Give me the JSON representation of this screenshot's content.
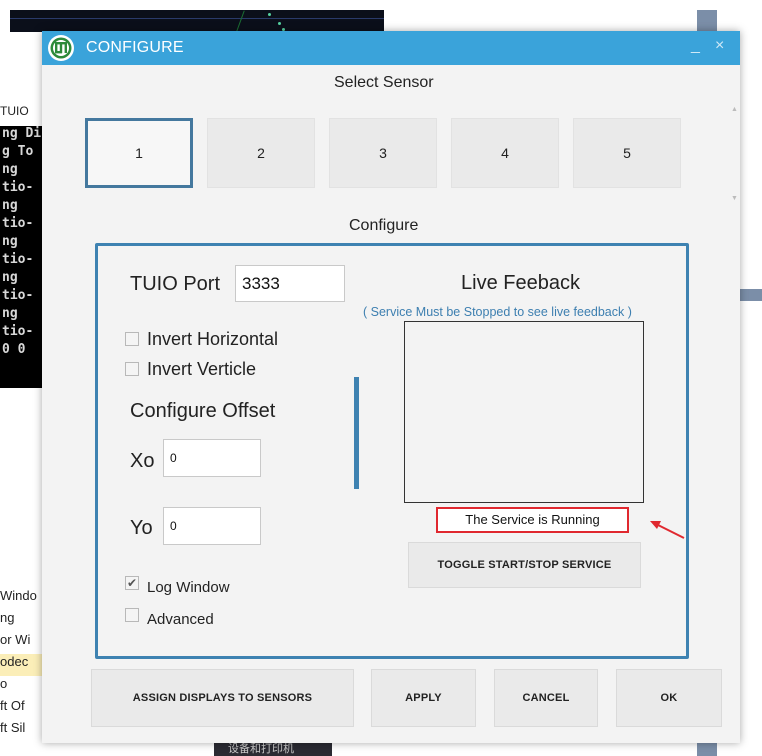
{
  "background": {
    "tuio_label": "TUIO",
    "console_lines": [
      "ng Di",
      "g To",
      "ng",
      "tio-",
      "ng",
      "tio-",
      "ng",
      "tio-",
      "ng",
      "tio-",
      "ng",
      "tio-",
      "0 0"
    ],
    "list_items": [
      "Windo",
      "ng",
      "or Wi",
      "odec",
      "o",
      "ft Of",
      "ft Sil"
    ],
    "bottom_text": "设备和打印机"
  },
  "dialog": {
    "title": "CONFIGURE",
    "minimize_glyph": "_",
    "close_glyph": "×",
    "select_sensor_label": "Select Sensor",
    "sensors": [
      "1",
      "2",
      "3",
      "4",
      "5"
    ],
    "configure_label": "Configure",
    "tuio_port_label": "TUIO Port",
    "tuio_port_value": "3333",
    "invert_horizontal_label": "Invert Horizontal",
    "invert_verticle_label": "Invert Verticle",
    "configure_offset_label": "Configure Offset",
    "xo_label": "Xo",
    "xo_value": "0",
    "yo_label": "Yo",
    "yo_value": "0",
    "log_window_label": "Log Window",
    "advanced_label": "Advanced",
    "log_window_checked": true,
    "advanced_checked": false,
    "invert_horizontal_checked": false,
    "invert_verticle_checked": false,
    "live_feedback_title": "Live Feeback",
    "live_feedback_note": "( Service Must be Stopped to see live feedback )",
    "service_status": "The Service is Running",
    "toggle_button": "TOGGLE START/STOP SERVICE",
    "assign_button": "ASSIGN DISPLAYS TO SENSORS",
    "apply_button": "APPLY",
    "cancel_button": "CANCEL",
    "ok_button": "OK",
    "check_glyph": "✔"
  },
  "colors": {
    "titlebar": "#3aa3da",
    "panel_border": "#3e82b1",
    "status_border": "#e0282f",
    "feedback_note": "#3d7fb0"
  }
}
